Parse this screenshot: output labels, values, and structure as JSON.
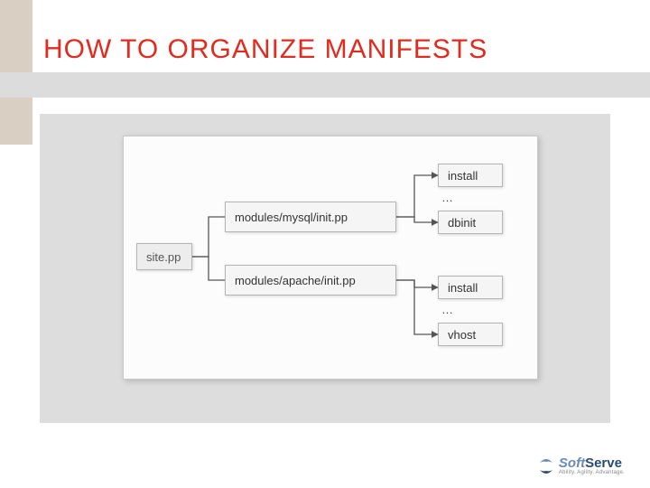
{
  "title": "HOW TO ORGANIZE MANIFESTS",
  "diagram": {
    "root": "site.pp",
    "modules": {
      "mysql": "modules/mysql/init.pp",
      "apache": "modules/apache/init.pp"
    },
    "leaves": {
      "install1": "install",
      "dbinit": "dbinit",
      "install2": "install",
      "vhost": "vhost"
    },
    "ellipsis": "…"
  },
  "logo": {
    "name_a": "Soft",
    "name_b": "Serve",
    "tagline": "Ability. Agility. Advantage."
  }
}
